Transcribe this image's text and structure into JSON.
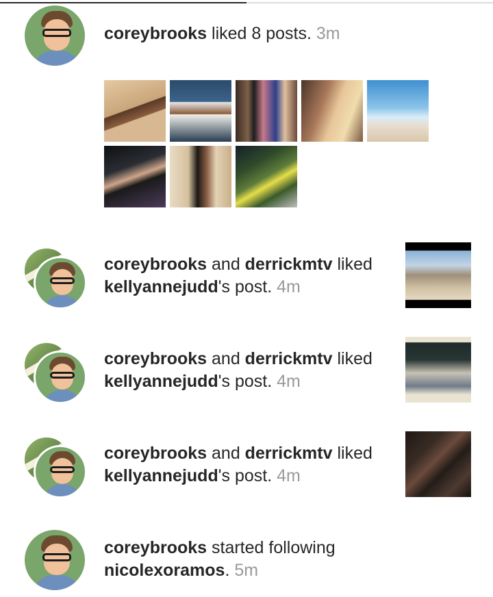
{
  "notifications": [
    {
      "user1": "coreybrooks",
      "action": " liked 8 posts. ",
      "time": "3m",
      "thumbnails": [
        {
          "icon": "beach-photo"
        },
        {
          "icon": "dogs-in-car-photo"
        },
        {
          "icon": "group-photo"
        },
        {
          "icon": "selfie-photo"
        },
        {
          "icon": "umbrella-desert-photo"
        },
        {
          "icon": "concert-photo"
        },
        {
          "icon": "stairs-photo"
        },
        {
          "icon": "flowers-hat-photo"
        }
      ]
    },
    {
      "user1": "coreybrooks",
      "conj": " and ",
      "user2": "derrickmtv",
      "action": " liked",
      "owner": "kellyannejudd",
      "suffix": "'s post. ",
      "time": "4m"
    },
    {
      "user1": "coreybrooks",
      "conj": " and ",
      "user2": "derrickmtv",
      "action": " liked",
      "owner": "kellyannejudd",
      "suffix": "'s post. ",
      "time": "4m"
    },
    {
      "user1": "coreybrooks",
      "conj": " and ",
      "user2": "derrickmtv",
      "action": " liked",
      "owner": "kellyannejudd",
      "suffix": "'s post. ",
      "time": "4m"
    },
    {
      "user1": "coreybrooks",
      "action": " started following",
      "target": "nicolexoramos",
      "suffix": ". ",
      "time": "5m"
    }
  ]
}
